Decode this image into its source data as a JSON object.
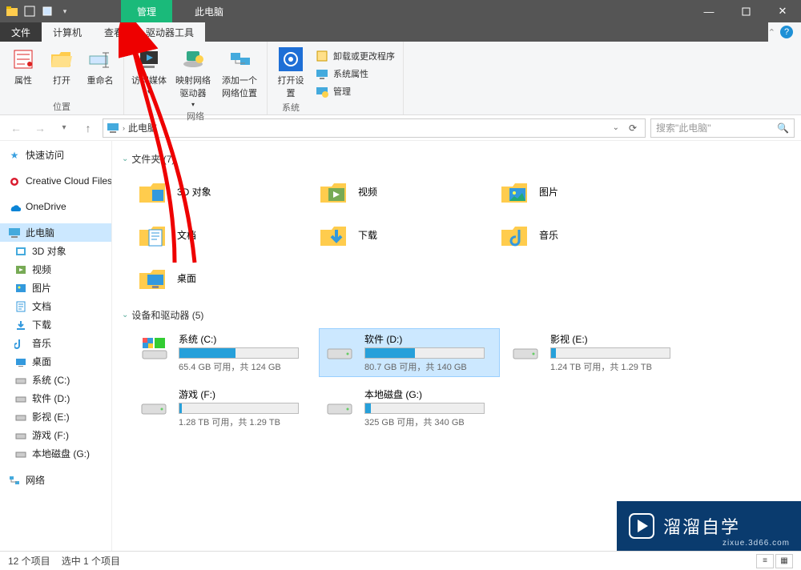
{
  "titlebar": {
    "manage_tab": "管理",
    "app_title": "此电脑"
  },
  "menutabs": {
    "file": "文件",
    "computer": "计算机",
    "view": "查看",
    "drive_tools": "驱动器工具"
  },
  "ribbon": {
    "properties": "属性",
    "open": "打开",
    "rename": "重命名",
    "group_location": "位置",
    "access_media": "访问媒体",
    "map_drive": "映射网络驱动器",
    "add_net_loc": "添加一个网络位置",
    "group_network": "网络",
    "open_settings": "打开设置",
    "uninstall_change": "卸载或更改程序",
    "system_props": "系统属性",
    "manage": "管理",
    "group_system": "系统"
  },
  "nav": {
    "location": "此电脑",
    "search_placeholder": "搜索\"此电脑\""
  },
  "sidebar": {
    "quick_access": "快速访问",
    "creative_cloud": "Creative Cloud Files",
    "onedrive": "OneDrive",
    "this_pc": "此电脑",
    "items": [
      "3D 对象",
      "视频",
      "图片",
      "文档",
      "下载",
      "音乐",
      "桌面",
      "系统 (C:)",
      "软件 (D:)",
      "影视 (E:)",
      "游戏 (F:)",
      "本地磁盘 (G:)"
    ],
    "network": "网络"
  },
  "sections": {
    "folders": "文件夹 (7)",
    "drives": "设备和驱动器 (5)"
  },
  "folders": [
    {
      "label": "3D 对象"
    },
    {
      "label": "视频"
    },
    {
      "label": "图片"
    },
    {
      "label": "文档"
    },
    {
      "label": "下载"
    },
    {
      "label": "音乐"
    },
    {
      "label": "桌面"
    }
  ],
  "drives": [
    {
      "name": "系统 (C:)",
      "stat": "65.4 GB 可用，共 124 GB",
      "fill": 47,
      "icon": "win"
    },
    {
      "name": "软件 (D:)",
      "stat": "80.7 GB 可用，共 140 GB",
      "fill": 42,
      "icon": "hdd",
      "selected": true
    },
    {
      "name": "影视 (E:)",
      "stat": "1.24 TB 可用，共 1.29 TB",
      "fill": 4,
      "icon": "hdd"
    },
    {
      "name": "游戏 (F:)",
      "stat": "1.28 TB 可用，共 1.29 TB",
      "fill": 2,
      "icon": "hdd"
    },
    {
      "name": "本地磁盘 (G:)",
      "stat": "325 GB 可用，共 340 GB",
      "fill": 5,
      "icon": "hdd"
    }
  ],
  "status": {
    "count": "12 个项目",
    "selected": "选中 1 个项目"
  },
  "watermark": {
    "text": "溜溜自学",
    "sub": "zixue.3d66.com"
  }
}
